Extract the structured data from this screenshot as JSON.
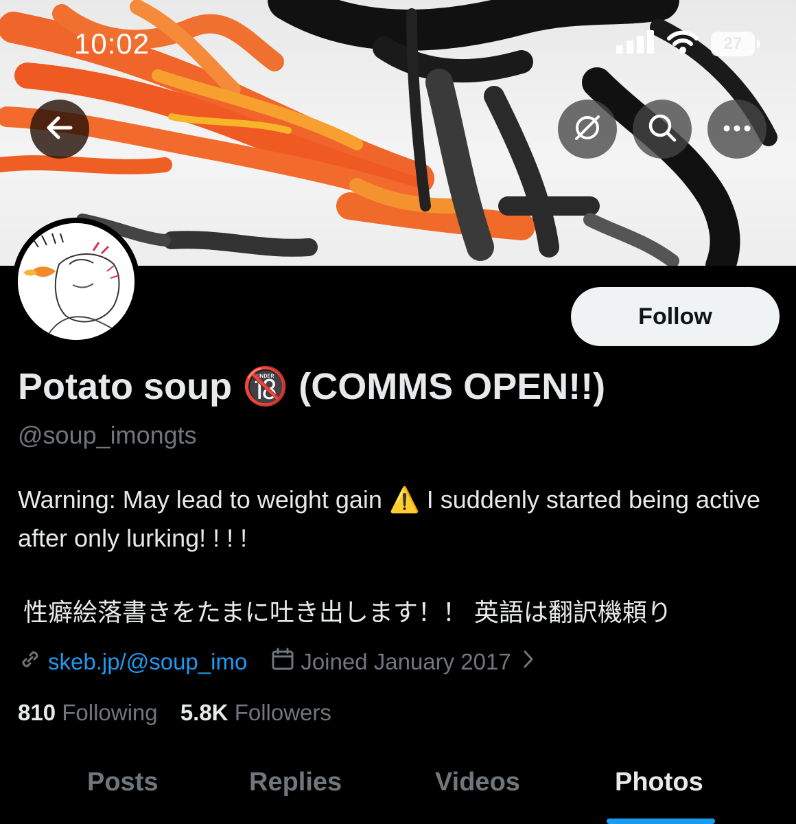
{
  "status_bar": {
    "time": "10:02",
    "battery": "27",
    "icons": [
      "cellular-signal-icon",
      "wifi-icon",
      "battery-icon"
    ]
  },
  "nav": {
    "back_icon": "arrow-left-icon",
    "actions": [
      "hide-icon",
      "search-icon",
      "more-icon"
    ]
  },
  "profile": {
    "follow_label": "Follow",
    "name": "Potato soup 🔞 (COMMS OPEN!!)",
    "handle": "@soup_imongts",
    "bio_line1": "Warning: May lead to weight gain ⚠️ I suddenly started being active after only lurking! ! ! !",
    "bio_line2": "性癖絵落書きをたまに吐き出します！！ 英語は翻訳機頼り",
    "link": "skeb.jp/@soup_imo",
    "joined": "Joined January 2017",
    "following_count": "810",
    "following_label": "Following",
    "followers_count": "5.8K",
    "followers_label": "Followers"
  },
  "tabs": [
    {
      "label": "Posts"
    },
    {
      "label": "Replies"
    },
    {
      "label": "Videos"
    },
    {
      "label": "Photos",
      "active": true
    }
  ],
  "colors": {
    "accent": "#1d9bf0",
    "background": "#000000",
    "secondary_text": "#71767b"
  }
}
